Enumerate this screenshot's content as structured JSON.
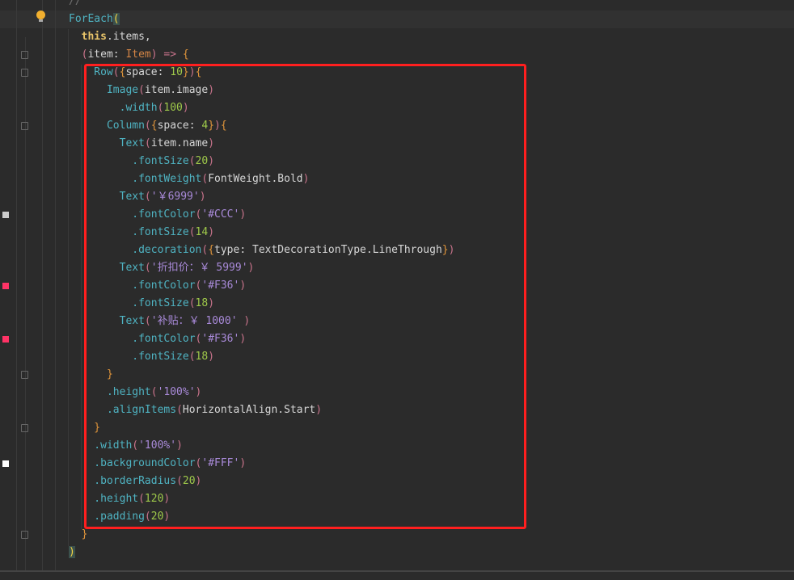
{
  "editor": {
    "current_line_index": 1,
    "lines": [
      [
        [
          "//",
          "comment"
        ]
      ],
      [
        [
          "ForEach",
          "fn"
        ],
        [
          "(",
          "match"
        ]
      ],
      [
        [
          "  this",
          "kw"
        ],
        [
          ".items,",
          "plain"
        ]
      ],
      [
        [
          "  ",
          "plain"
        ],
        [
          "(",
          "paren"
        ],
        [
          "item: ",
          "plain"
        ],
        [
          "Item",
          "type"
        ],
        [
          ") => ",
          "paren"
        ],
        [
          "{",
          "brace"
        ]
      ],
      [
        [
          "    Row",
          "fn"
        ],
        [
          "(",
          "paren"
        ],
        [
          "{",
          "brace"
        ],
        [
          "space: ",
          "plain"
        ],
        [
          "10",
          "num"
        ],
        [
          "}",
          "brace"
        ],
        [
          ")",
          "paren"
        ],
        [
          "{",
          "brace"
        ]
      ],
      [
        [
          "      Image",
          "fn"
        ],
        [
          "(",
          "paren"
        ],
        [
          "item.image",
          "plain"
        ],
        [
          ")",
          "paren"
        ]
      ],
      [
        [
          "        .width",
          "fn"
        ],
        [
          "(",
          "paren"
        ],
        [
          "100",
          "num"
        ],
        [
          ")",
          "paren"
        ]
      ],
      [
        [
          "      Column",
          "fn"
        ],
        [
          "(",
          "paren"
        ],
        [
          "{",
          "brace"
        ],
        [
          "space: ",
          "plain"
        ],
        [
          "4",
          "num"
        ],
        [
          "}",
          "brace"
        ],
        [
          ")",
          "paren"
        ],
        [
          "{",
          "brace"
        ]
      ],
      [
        [
          "        Text",
          "fn"
        ],
        [
          "(",
          "paren"
        ],
        [
          "item.name",
          "plain"
        ],
        [
          ")",
          "paren"
        ]
      ],
      [
        [
          "          .fontSize",
          "fn"
        ],
        [
          "(",
          "paren"
        ],
        [
          "20",
          "num"
        ],
        [
          ")",
          "paren"
        ]
      ],
      [
        [
          "          .fontWeight",
          "fn"
        ],
        [
          "(",
          "paren"
        ],
        [
          "FontWeight.Bold",
          "plain"
        ],
        [
          ")",
          "paren"
        ]
      ],
      [
        [
          "        Text",
          "fn"
        ],
        [
          "(",
          "paren"
        ],
        [
          "'￥6999'",
          "str"
        ],
        [
          ")",
          "paren"
        ]
      ],
      [
        [
          "          .fontColor",
          "fn"
        ],
        [
          "(",
          "paren"
        ],
        [
          "'#CCC'",
          "str"
        ],
        [
          ")",
          "paren"
        ]
      ],
      [
        [
          "          .fontSize",
          "fn"
        ],
        [
          "(",
          "paren"
        ],
        [
          "14",
          "num"
        ],
        [
          ")",
          "paren"
        ]
      ],
      [
        [
          "          .decoration",
          "fn"
        ],
        [
          "(",
          "paren"
        ],
        [
          "{",
          "brace"
        ],
        [
          "type: TextDecorationType.LineThrough",
          "plain"
        ],
        [
          "}",
          "brace"
        ],
        [
          ")",
          "paren"
        ]
      ],
      [
        [
          "        Text",
          "fn"
        ],
        [
          "(",
          "paren"
        ],
        [
          "'折扣价：￥ 5999'",
          "str"
        ],
        [
          ")",
          "paren"
        ]
      ],
      [
        [
          "          .fontColor",
          "fn"
        ],
        [
          "(",
          "paren"
        ],
        [
          "'#F36'",
          "str"
        ],
        [
          ")",
          "paren"
        ]
      ],
      [
        [
          "          .fontSize",
          "fn"
        ],
        [
          "(",
          "paren"
        ],
        [
          "18",
          "num"
        ],
        [
          ")",
          "paren"
        ]
      ],
      [
        [
          "        Text",
          "fn"
        ],
        [
          "(",
          "paren"
        ],
        [
          "'补贴：￥ 1000'",
          "str"
        ],
        [
          " )",
          "paren"
        ]
      ],
      [
        [
          "          .fontColor",
          "fn"
        ],
        [
          "(",
          "paren"
        ],
        [
          "'#F36'",
          "str"
        ],
        [
          ")",
          "paren"
        ]
      ],
      [
        [
          "          .fontSize",
          "fn"
        ],
        [
          "(",
          "paren"
        ],
        [
          "18",
          "num"
        ],
        [
          ")",
          "paren"
        ]
      ],
      [
        [
          "      }",
          "brace"
        ]
      ],
      [
        [
          "      .height",
          "fn"
        ],
        [
          "(",
          "paren"
        ],
        [
          "'100%'",
          "str"
        ],
        [
          ")",
          "paren"
        ]
      ],
      [
        [
          "      .alignItems",
          "fn"
        ],
        [
          "(",
          "paren"
        ],
        [
          "HorizontalAlign.Start",
          "plain"
        ],
        [
          ")",
          "paren"
        ]
      ],
      [
        [
          "    }",
          "brace"
        ]
      ],
      [
        [
          "    .width",
          "fn"
        ],
        [
          "(",
          "paren"
        ],
        [
          "'100%'",
          "str"
        ],
        [
          ")",
          "paren"
        ]
      ],
      [
        [
          "    .backgroundColor",
          "fn"
        ],
        [
          "(",
          "paren"
        ],
        [
          "'#FFF'",
          "str"
        ],
        [
          ")",
          "paren"
        ]
      ],
      [
        [
          "    .borderRadius",
          "fn"
        ],
        [
          "(",
          "paren"
        ],
        [
          "20",
          "num"
        ],
        [
          ")",
          "paren"
        ]
      ],
      [
        [
          "    .height",
          "fn"
        ],
        [
          "(",
          "paren"
        ],
        [
          "120",
          "num"
        ],
        [
          ")",
          "paren"
        ]
      ],
      [
        [
          "    .padding",
          "fn"
        ],
        [
          "(",
          "paren"
        ],
        [
          "20",
          "num"
        ],
        [
          ")",
          "paren"
        ]
      ],
      [
        [
          "  }",
          "brace"
        ]
      ],
      [
        [
          ")",
          "match"
        ]
      ]
    ],
    "fold_markers_at_lines": [
      3,
      4,
      7,
      21,
      24,
      30
    ],
    "color_markers": [
      {
        "line": 12,
        "color": "#CCCCCC"
      },
      {
        "line": 16,
        "color": "#FF3366"
      },
      {
        "line": 19,
        "color": "#FF3366"
      },
      {
        "line": 26,
        "color": "#FFFFFF"
      }
    ],
    "highlight_box_color": "#FF1F1F"
  }
}
